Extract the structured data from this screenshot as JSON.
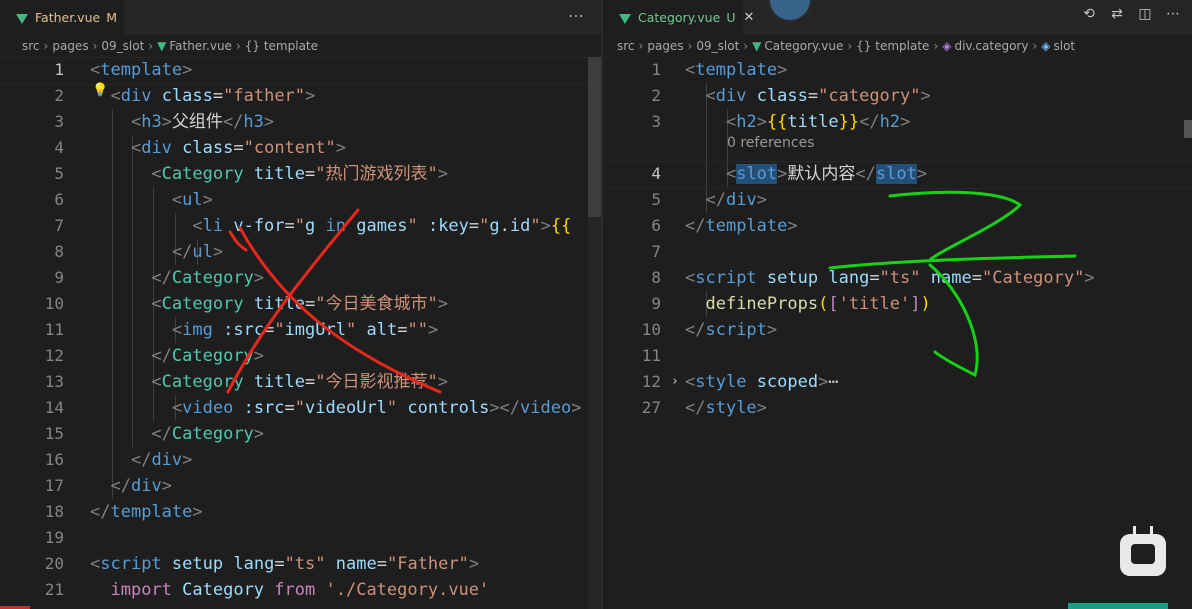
{
  "left": {
    "tab": {
      "icon": "vue-icon",
      "name": "Father.vue",
      "badge": "M"
    },
    "more": "⋯",
    "breadcrumb": [
      "src",
      "pages",
      "09_slot",
      "Father.vue",
      "{} template"
    ]
  },
  "right": {
    "tab": {
      "icon": "vue-icon",
      "name": "Category.vue",
      "badge": "U",
      "close": "✕"
    },
    "breadcrumb": [
      "src",
      "pages",
      "09_slot",
      "Category.vue",
      "{} template",
      "div.category",
      "slot"
    ],
    "lens": "0 references"
  },
  "colors": {
    "annotation_red": "#e8271d",
    "annotation_green": "#17d117",
    "vue": "#41b883"
  }
}
